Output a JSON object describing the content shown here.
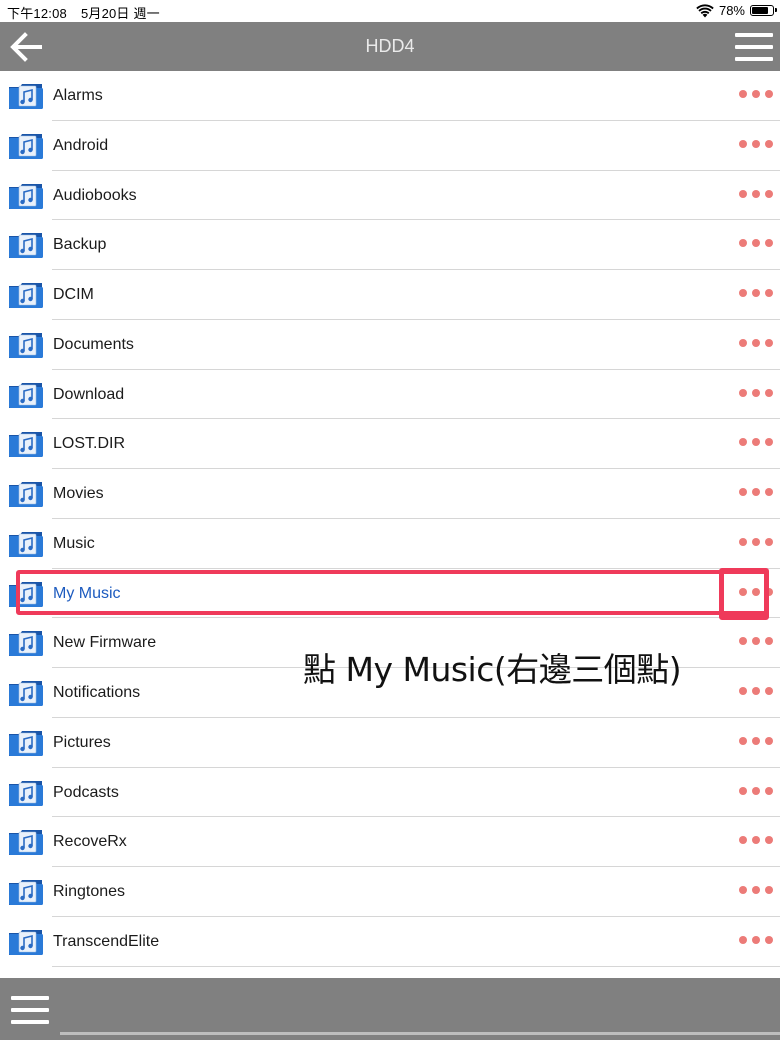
{
  "status_bar": {
    "time": "下午12:08",
    "date": "5月20日 週一",
    "battery": "78%",
    "battery_level": 0.78
  },
  "nav": {
    "title": "HDD4",
    "back_icon": "back-arrow-icon",
    "menu_icon": "hamburger-menu-icon"
  },
  "folders": [
    {
      "label": "Alarms"
    },
    {
      "label": "Android"
    },
    {
      "label": "Audiobooks"
    },
    {
      "label": "Backup"
    },
    {
      "label": "DCIM"
    },
    {
      "label": "Documents"
    },
    {
      "label": "Download"
    },
    {
      "label": "LOST.DIR"
    },
    {
      "label": "Movies"
    },
    {
      "label": "Music"
    },
    {
      "label": "My Music"
    },
    {
      "label": "New Firmware"
    },
    {
      "label": "Notifications"
    },
    {
      "label": "Pictures"
    },
    {
      "label": "Podcasts"
    },
    {
      "label": "RecoveRx"
    },
    {
      "label": "Ringtones"
    },
    {
      "label": "TranscendElite"
    }
  ],
  "highlighted_folder": "My Music",
  "annotation": "點 My Music(右邊三個點)",
  "colors": {
    "bar_gray": "#808080",
    "dots": "#ec7b78",
    "highlight": "#ef3a5a",
    "active_text": "#1d5bbf",
    "folder_blue": "#1f6fd0"
  }
}
